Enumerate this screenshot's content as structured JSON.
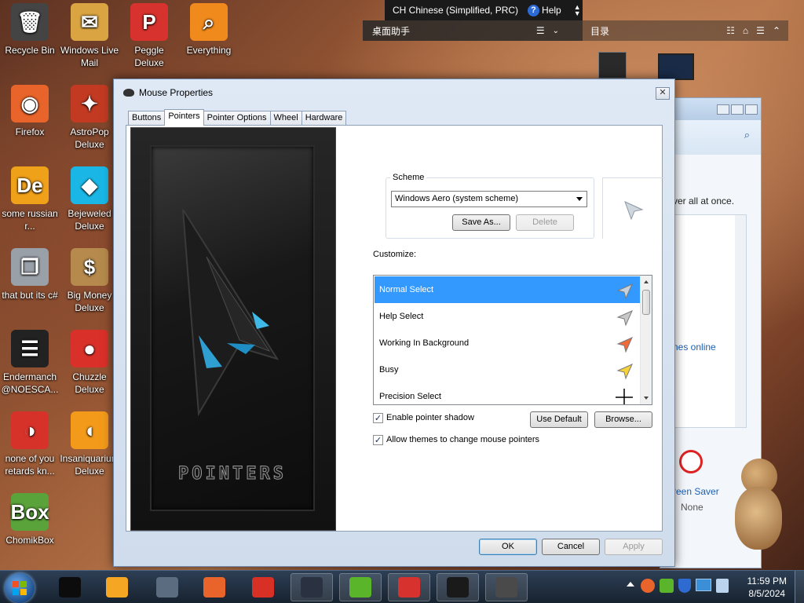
{
  "desktop": {
    "icons": [
      {
        "label": "Recycle Bin",
        "icon": "recycle-bin-icon",
        "color": "#444"
      },
      {
        "label": "Windows Live Mail",
        "icon": "mail-icon",
        "color": "#d9a441"
      },
      {
        "label": "Peggle Deluxe",
        "icon": "peggle-icon",
        "color": "#d8322e"
      },
      {
        "label": "Everything",
        "icon": "magnifier-icon",
        "color": "#f08a1c"
      },
      {
        "label": "Firefox",
        "icon": "firefox-icon",
        "color": "#e8642a"
      },
      {
        "label": "AstroPop Deluxe",
        "icon": "astropop-icon",
        "color": "#c23a22"
      },
      {
        "label": "some russian r...",
        "icon": "de-icon",
        "color": "#f0a11a"
      },
      {
        "label": "Bejeweled Deluxe",
        "icon": "gem-icon",
        "color": "#1ab7e6"
      },
      {
        "label": "that but its c#",
        "icon": "copy-icon",
        "color": "#9aa0a8"
      },
      {
        "label": "Big Money Deluxe",
        "icon": "money-bag-icon",
        "color": "#b58a4c"
      },
      {
        "label": "Endermanch @NOESCA...",
        "icon": "terminal-icon",
        "color": "#222"
      },
      {
        "label": "Chuzzle Deluxe",
        "icon": "chuzzle-icon",
        "color": "#d9302a"
      },
      {
        "label": "none of you retards kn...",
        "icon": "dino-icon",
        "color": "#d6322a"
      },
      {
        "label": "Insaniquarium Deluxe",
        "icon": "fish-icon",
        "color": "#f39a1a"
      },
      {
        "label": "ChomikBox",
        "icon": "hamster-icon",
        "color": "#5aa33a"
      }
    ]
  },
  "ime_bar": {
    "language": "CH Chinese (Simplified, PRC)",
    "help": "Help"
  },
  "assistant_bar": {
    "left_title": "桌面助手",
    "right_title": "目录"
  },
  "background_window": {
    "text_1": "ver all at once.",
    "text_2": "nes online",
    "screen_saver_label": "reen Saver",
    "screen_saver_value": "None"
  },
  "dialog": {
    "title": "Mouse Properties",
    "close_glyph": "✕",
    "tabs": [
      "Buttons",
      "Pointers",
      "Pointer Options",
      "Wheel",
      "Hardware"
    ],
    "active_tab": "Pointers",
    "preview_logo_text": "POINTERS",
    "scheme_label": "Scheme",
    "scheme_value": "Windows Aero (system scheme)",
    "save_as_label": "Save As...",
    "delete_label": "Delete",
    "customize_label": "Customize:",
    "pointers": [
      {
        "name": "Normal Select",
        "selected": true,
        "cursor_color": "#c8d2dc"
      },
      {
        "name": "Help Select",
        "selected": false,
        "cursor_color": "#c8c8c8"
      },
      {
        "name": "Working In Background",
        "selected": false,
        "cursor_color": "#f06a3a"
      },
      {
        "name": "Busy",
        "selected": false,
        "cursor_color": "#f5d23a"
      },
      {
        "name": "Precision Select",
        "selected": false,
        "cursor_color": "#000000"
      }
    ],
    "enable_shadow_label": "Enable pointer shadow",
    "enable_shadow_checked": true,
    "allow_themes_label": "Allow themes to change mouse pointers",
    "allow_themes_checked": true,
    "use_default_label": "Use Default",
    "browse_label": "Browse...",
    "ok_label": "OK",
    "cancel_label": "Cancel",
    "apply_label": "Apply",
    "check_glyph": "✓"
  },
  "taskbar": {
    "time": "11:59 PM",
    "date": "8/5/2024",
    "apps": [
      {
        "icon": "black-box-icon",
        "color": "#0c0c0c"
      },
      {
        "icon": "media-player-icon",
        "color": "#f5a623"
      },
      {
        "icon": "cursor-app-icon",
        "color": "#5c6c80"
      },
      {
        "icon": "firefox-icon",
        "color": "#e8642a"
      },
      {
        "icon": "wps-icon",
        "color": "#d93025"
      },
      {
        "icon": "monitor-icon",
        "color": "#2a3140"
      },
      {
        "icon": "plus-app-icon",
        "color": "#5ab52a"
      },
      {
        "icon": "peggle-icon",
        "color": "#d8322e"
      },
      {
        "icon": "terminal-icon",
        "color": "#1a1a1a"
      },
      {
        "icon": "mouse-icon",
        "color": "#4a4a4a"
      }
    ]
  }
}
